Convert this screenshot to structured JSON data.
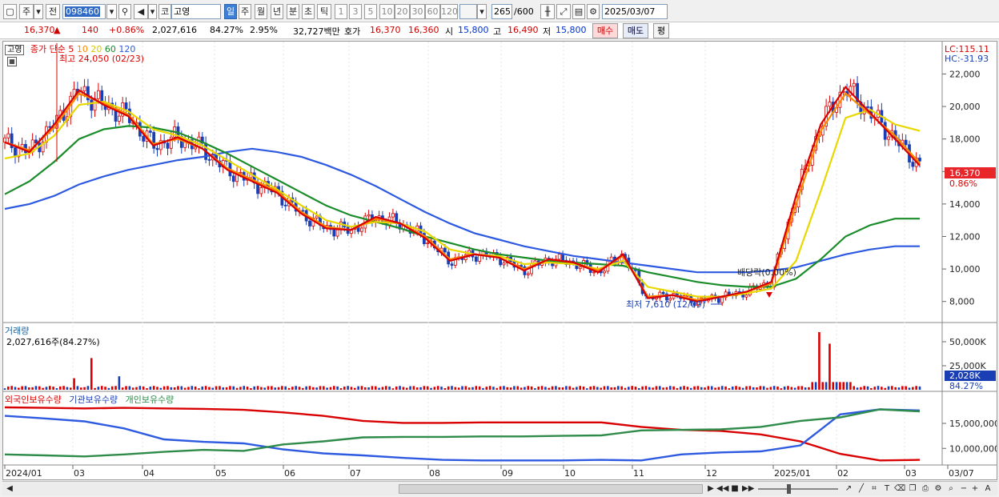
{
  "toolbar": {
    "market_label": "주",
    "prev_label": "전",
    "stock_code": "098460",
    "type_label": "코",
    "stock_name": "고영",
    "periods": [
      "일",
      "주",
      "월",
      "년",
      "분",
      "초",
      "틱"
    ],
    "active_period": "일",
    "intervals": [
      "1",
      "3",
      "5",
      "10",
      "20",
      "30",
      "60",
      "120"
    ],
    "count": "265",
    "count_total": "/600",
    "date": "2025/03/07"
  },
  "quote": {
    "price": "16,370",
    "direction": "▲",
    "change": "140",
    "change_pct": "+0.86%",
    "volume": "2,027,616",
    "volume_ratio": "84.27%",
    "turnover": "2.95%",
    "amount": "32,727백만",
    "ask_label": "호가",
    "ask1": "16,370",
    "ask2": "16,360",
    "open_label": "시",
    "open": "15,800",
    "high_label": "고",
    "high": "16,490",
    "low_label": "저",
    "low": "15,800",
    "buy_label": "매수",
    "sell_label": "매도",
    "eval_label": "평"
  },
  "price_panel": {
    "name_tag": "고영",
    "ma_label": "종가 단순",
    "ma_periods": [
      "5",
      "10",
      "20",
      "60",
      "120"
    ],
    "ma_colors": [
      "#d80000",
      "#ff8a00",
      "#e8d800",
      "#1a8c2a",
      "#2d5ae0"
    ],
    "lc_label": "LC:115.11",
    "hc_label": "HC:-31.93",
    "high_note": "최고 24,050 (02/23)",
    "low_note": "최저 7,610 (12/09)",
    "dividend_note": "배당락(0.00%)",
    "last_price_tag": "16,370",
    "last_pct_tag": "0.86%",
    "y_ticks": [
      "22,000",
      "20,000",
      "18,000",
      "16,000",
      "14,000",
      "12,000",
      "10,000",
      "8,000"
    ]
  },
  "volume_panel": {
    "title": "거래량",
    "value_text": "2,027,616주(84.27%)",
    "y_ticks": [
      "50,000K",
      "25,000K"
    ],
    "last_tag": "2,028K",
    "last_pct": "84.27%"
  },
  "holdings_panel": {
    "legend": [
      "외국인보유수량",
      "기관보유수량",
      "개인보유수량"
    ],
    "colors": [
      "#d80000",
      "#2d5ae0",
      "#2e8b4a"
    ],
    "y_ticks": [
      "15,000,000",
      "10,000,000"
    ]
  },
  "x_axis": [
    "2024/01",
    "03",
    "04",
    "05",
    "06",
    "07",
    "08",
    "09",
    "10",
    "11",
    "12",
    "2025/01",
    "02",
    "03",
    "03/07"
  ],
  "chart_data": {
    "type": "line",
    "title": "",
    "series": [
      {
        "name": "종가",
        "values": [
          17800,
          17200,
          18900,
          21000,
          20100,
          19400,
          17600,
          18100,
          17400,
          16100,
          15400,
          14700,
          13400,
          12500,
          12400,
          13200,
          12800,
          11900,
          10500,
          10900,
          10700,
          9900,
          10600,
          10400,
          9800,
          10900,
          8200,
          8400,
          8000,
          8300,
          8600,
          9200,
          14500,
          18900,
          21200,
          19600,
          18000,
          16370
        ]
      },
      {
        "name": "5",
        "values": [
          17800,
          17300,
          18700,
          20800,
          20200,
          19500,
          17700,
          18000,
          17400,
          16200,
          15500,
          14800,
          13500,
          12600,
          12400,
          13100,
          12800,
          12000,
          10600,
          10900,
          10700,
          10000,
          10600,
          10400,
          9900,
          10800,
          8300,
          8400,
          8100,
          8300,
          8600,
          9100,
          14000,
          18500,
          20800,
          19500,
          18200,
          16500
        ]
      },
      {
        "name": "20",
        "values": [
          16800,
          17100,
          18200,
          20100,
          20300,
          19700,
          18600,
          18200,
          17600,
          16700,
          15800,
          14900,
          13900,
          13000,
          12600,
          12900,
          12800,
          12300,
          11200,
          10900,
          10800,
          10300,
          10400,
          10300,
          10000,
          10500,
          8900,
          8600,
          8300,
          8300,
          8500,
          8800,
          10500,
          14800,
          19300,
          19800,
          18900,
          18500
        ]
      },
      {
        "name": "60",
        "values": [
          14600,
          15400,
          16600,
          18000,
          18600,
          18800,
          18700,
          18400,
          17800,
          17100,
          16300,
          15500,
          14700,
          13900,
          13300,
          12900,
          12500,
          12000,
          11600,
          11200,
          10900,
          10700,
          10500,
          10400,
          10300,
          10200,
          9800,
          9500,
          9200,
          9000,
          8900,
          8900,
          9400,
          10600,
          12000,
          12700,
          13100,
          13100
        ]
      },
      {
        "name": "120",
        "values": [
          13700,
          14000,
          14500,
          15200,
          15700,
          16100,
          16400,
          16700,
          16900,
          17200,
          17400,
          17200,
          16900,
          16400,
          15800,
          15100,
          14300,
          13500,
          12800,
          12200,
          11800,
          11400,
          11100,
          10800,
          10600,
          10400,
          10200,
          10000,
          9800,
          9800,
          9800,
          9900,
          10100,
          10500,
          10900,
          11200,
          11400,
          11400
        ]
      }
    ],
    "volume_peak_k": 50000,
    "ylim": [
      7000,
      23500
    ]
  }
}
